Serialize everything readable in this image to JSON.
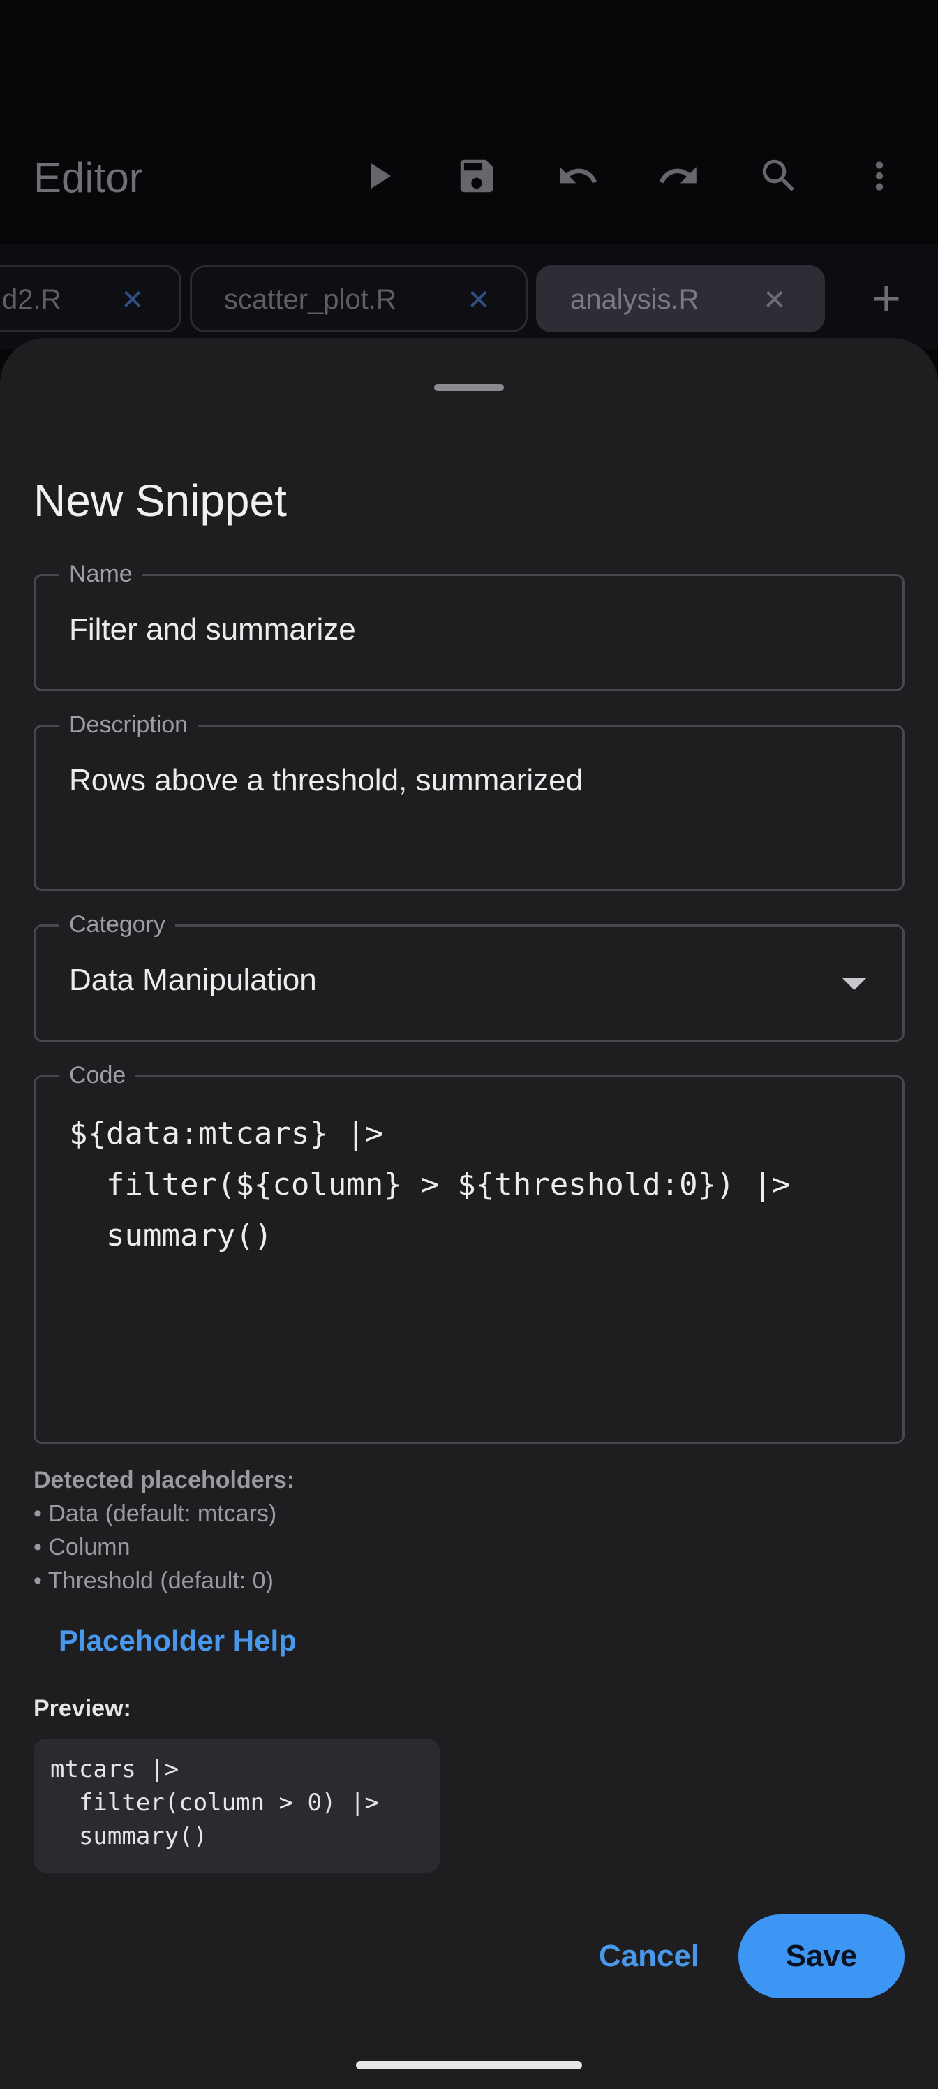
{
  "app": {
    "title": "Editor",
    "toolbar_icons": [
      "play-icon",
      "save-icon",
      "undo-icon",
      "redo-icon",
      "search-icon",
      "more-vert-icon"
    ]
  },
  "tabs": [
    {
      "label": "d2.R",
      "close": "✕"
    },
    {
      "label": "scatter_plot.R",
      "close": "✕"
    },
    {
      "label": "analysis.R",
      "close": "✕",
      "active": true
    }
  ],
  "tab_add": "+",
  "sheet": {
    "title": "New Snippet",
    "name_field": {
      "label": "Name",
      "value": "Filter and summarize"
    },
    "description_field": {
      "label": "Description",
      "value": "Rows above a threshold, summarized"
    },
    "category_field": {
      "label": "Category",
      "value": "Data Manipulation"
    },
    "code_field": {
      "label": "Code",
      "lines": [
        "${data:mtcars} |>",
        "  filter(${column} > ${threshold:0}) |>",
        "  summary()"
      ]
    },
    "detected": {
      "header": "Detected placeholders:",
      "items": [
        "• Data (default: mtcars)",
        "• Column",
        "• Threshold (default: 0)"
      ]
    },
    "help_link": "Placeholder Help",
    "preview": {
      "label": "Preview:",
      "lines": [
        "mtcars |>",
        "  filter(column > 0) |>",
        "  summary()"
      ]
    },
    "buttons": {
      "cancel": "Cancel",
      "save": "Save"
    }
  },
  "colors": {
    "accent": "#3d95f4",
    "link": "#4a98ec",
    "sheet_bg": "#1e1e21"
  }
}
